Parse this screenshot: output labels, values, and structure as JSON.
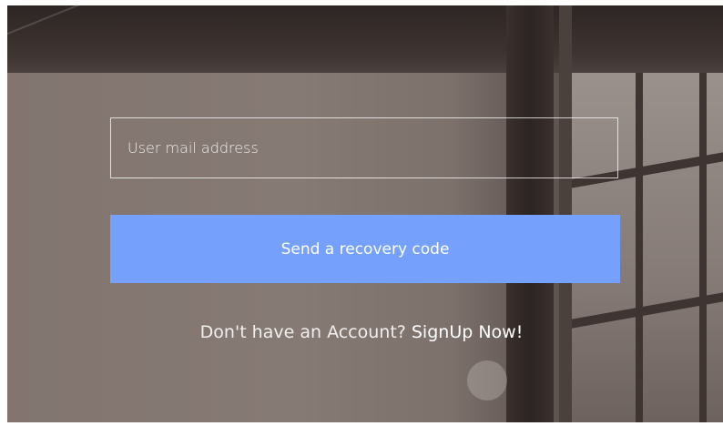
{
  "recovery_form": {
    "email_placeholder": "User mail address",
    "email_value": "",
    "submit_label": "Send a recovery code",
    "signup_prompt": "Don't have an Account?",
    "signup_link": "SignUp Now!",
    "accent_color": "#75a0fc"
  }
}
